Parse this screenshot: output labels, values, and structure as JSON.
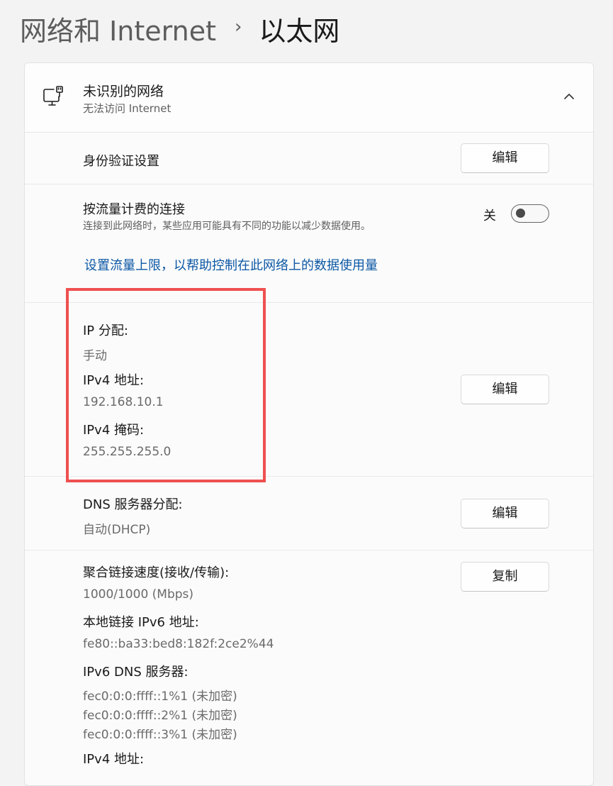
{
  "breadcrumb": {
    "parent": "网络和 Internet",
    "separator": "›",
    "current": "以太网"
  },
  "network": {
    "name": "未识别的网络",
    "status": "无法访问 Internet",
    "icon": "ethernet-pc-icon",
    "collapse_icon": "chevron-up-icon"
  },
  "auth": {
    "label": "身份验证设置",
    "button": "编辑"
  },
  "metered": {
    "label": "按流量计费的连接",
    "desc": "连接到此网络时，某些应用可能具有不同的功能以减少数据使用。",
    "state": "关",
    "toggle_on": false,
    "link": "设置流量上限，以帮助控制在此网络上的数据使用量"
  },
  "ip": {
    "assign_label": "IP 分配:",
    "assign_value": "手动",
    "ipv4_label": "IPv4 地址:",
    "ipv4_value": "192.168.10.1",
    "mask_label": "IPv4 掩码:",
    "mask_value": "255.255.255.0",
    "button": "编辑"
  },
  "dns": {
    "label": "DNS 服务器分配:",
    "value": "自动(DHCP)",
    "button": "编辑"
  },
  "props": {
    "speed_label": "聚合链接速度(接收/传输):",
    "speed_value": "1000/1000 (Mbps)",
    "ipv6_ll_label": "本地链接 IPv6 地址:",
    "ipv6_ll_value": "fe80::ba33:bed8:182f:2ce2%44",
    "ipv6_dns_label": "IPv6 DNS 服务器:",
    "ipv6_dns_values": [
      "fec0:0:0:ffff::1%1 (未加密)",
      "fec0:0:0:ffff::2%1 (未加密)",
      "fec0:0:0:ffff::3%1 (未加密)"
    ],
    "ipv4_label": "IPv4 地址:",
    "copy_button": "复制"
  },
  "colors": {
    "link": "#0b57a4",
    "highlight": "#ef5050",
    "background": "#f3f3f3",
    "card": "#fbfbfb"
  }
}
